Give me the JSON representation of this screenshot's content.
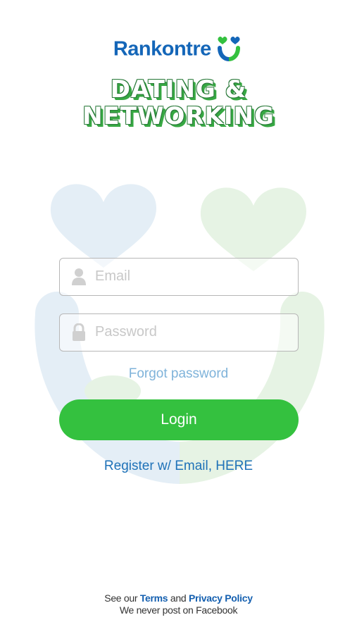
{
  "brand": {
    "name": "Rankontre",
    "logo_icon": "smile-hearts-icon",
    "colors": {
      "blue": "#1466b8",
      "green": "#34c13f"
    }
  },
  "headline": {
    "line1": "DATING &",
    "line2": "NETWORKING"
  },
  "form": {
    "email": {
      "placeholder": "Email",
      "value": "",
      "icon": "user-icon"
    },
    "password": {
      "placeholder": "Password",
      "value": "",
      "icon": "lock-icon"
    },
    "forgot_label": "Forgot password",
    "login_label": "Login",
    "register_label": "Register w/ Email, HERE"
  },
  "footer": {
    "prefix": "See our",
    "terms": "Terms",
    "and": "and",
    "privacy": "Privacy Policy",
    "note": "We never post on Facebook"
  }
}
